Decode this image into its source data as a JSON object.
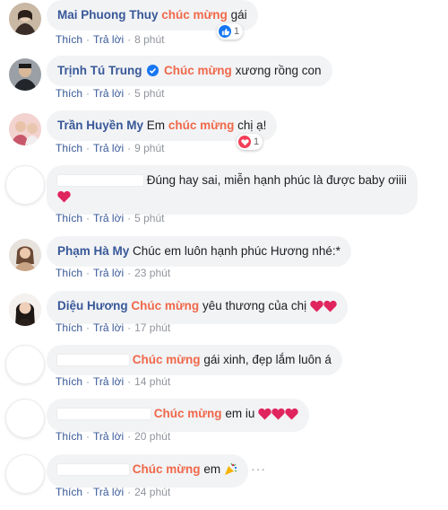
{
  "actions": {
    "like": "Thích",
    "reply": "Trả lời",
    "sep": "·"
  },
  "comments": [
    {
      "name": "Mai Phuong Thuy",
      "highlight": "chúc mừng",
      "text": "gái",
      "time": "8 phút",
      "reaction": {
        "type": "like",
        "count": "1"
      }
    },
    {
      "name": "Trịnh Tú Trung",
      "highlight": "Chúc mừng",
      "text": "xương rồng con",
      "time": "5 phút",
      "verified": true
    },
    {
      "name": "Trần Huyền My",
      "prefix": "Em",
      "highlight": "chúc mừng",
      "text": "chị ạ!",
      "time": "9 phút",
      "reaction": {
        "type": "love",
        "count": "1"
      }
    },
    {
      "text": "Đúng hay sai, miễn hạnh phúc là được baby ơiiii",
      "time": "5 phút"
    },
    {
      "name": "Phạm Hà My",
      "text": "Chúc em luôn hạnh phúc Hương nhé:*",
      "time": "23 phút"
    },
    {
      "name": "Diệu Hương",
      "highlight": "Chúc mừng",
      "text": "yêu thương của chị",
      "time": "17 phút"
    },
    {
      "highlight": "Chúc mừng",
      "text": "gái xinh, đẹp lắm luôn á",
      "time": "14 phút"
    },
    {
      "highlight": "Chúc mừng",
      "text": "em iu",
      "time": "20 phút"
    },
    {
      "highlight": "Chúc mừng",
      "text": "em",
      "time": "24 phút"
    }
  ],
  "colors": {
    "name": "#385898",
    "highlight": "#f0684a",
    "bubble": "#f2f3f5",
    "meta": "#90949c",
    "heart": "#e0245e",
    "like": "#1877f2"
  }
}
